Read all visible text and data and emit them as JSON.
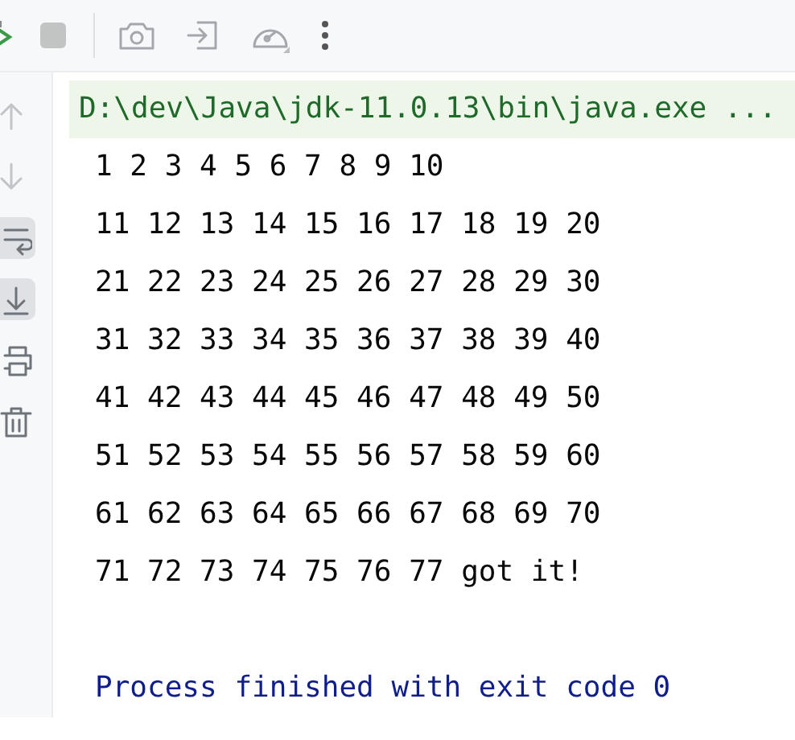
{
  "toolbar": [
    {
      "kind": "rerun",
      "disabled": false
    },
    {
      "kind": "stop",
      "disabled": true
    },
    {
      "kind": "divider"
    },
    {
      "kind": "camera",
      "disabled": true
    },
    {
      "kind": "exit",
      "disabled": true
    },
    {
      "kind": "gauge",
      "disabled": true
    },
    {
      "kind": "more",
      "disabled": false
    }
  ],
  "sidebar": [
    {
      "kind": "up",
      "disabled": true,
      "on": false
    },
    {
      "kind": "down",
      "disabled": true,
      "on": false
    },
    {
      "kind": "wrap",
      "disabled": false,
      "on": true
    },
    {
      "kind": "scroll-end",
      "disabled": false,
      "on": true
    },
    {
      "kind": "print",
      "disabled": false,
      "on": false
    },
    {
      "kind": "trash",
      "disabled": false,
      "on": false
    }
  ],
  "console": [
    {
      "kind": "command",
      "text": "D:\\dev\\Java\\jdk-11.0.13\\bin\\java.exe ..."
    },
    {
      "kind": "output",
      "text": "1 2 3 4 5 6 7 8 9 10"
    },
    {
      "kind": "output",
      "text": "11 12 13 14 15 16 17 18 19 20"
    },
    {
      "kind": "output",
      "text": "21 22 23 24 25 26 27 28 29 30"
    },
    {
      "kind": "output",
      "text": "31 32 33 34 35 36 37 38 39 40"
    },
    {
      "kind": "output",
      "text": "41 42 43 44 45 46 47 48 49 50"
    },
    {
      "kind": "output",
      "text": "51 52 53 54 55 56 57 58 59 60"
    },
    {
      "kind": "output",
      "text": "61 62 63 64 65 66 67 68 69 70"
    },
    {
      "kind": "output",
      "text": "71 72 73 74 75 76 77 got it!"
    },
    {
      "kind": "system",
      "text": "Process finished with exit code 0"
    }
  ]
}
